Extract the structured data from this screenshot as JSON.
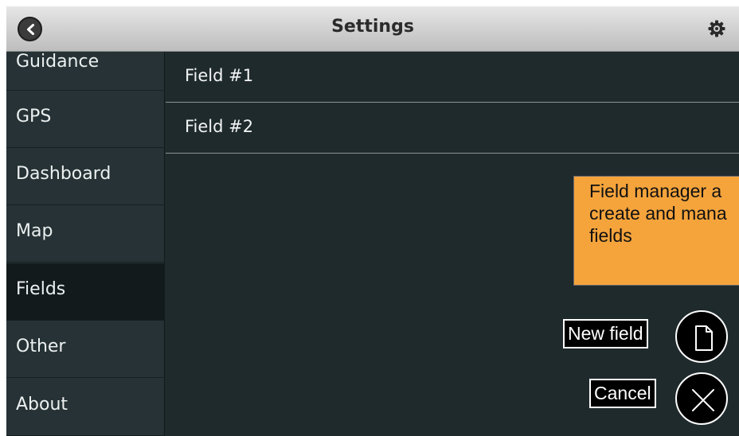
{
  "header": {
    "title": "Settings",
    "back_icon": "chevron-left-icon",
    "settings_icon": "gear-icon"
  },
  "sidebar": {
    "items": [
      {
        "label": "Guidance",
        "active": false
      },
      {
        "label": "GPS",
        "active": false
      },
      {
        "label": "Dashboard",
        "active": false
      },
      {
        "label": "Map",
        "active": false
      },
      {
        "label": "Fields",
        "active": true
      },
      {
        "label": "Other",
        "active": false
      },
      {
        "label": "About",
        "active": false
      }
    ]
  },
  "main": {
    "fields": [
      "Field #1",
      "Field #2"
    ]
  },
  "tooltip": {
    "text": "Field manager a\ncreate and mana\nfields"
  },
  "actions": {
    "new_field_label": "New field",
    "new_field_icon": "document-icon",
    "cancel_label": "Cancel",
    "cancel_icon": "close-icon"
  },
  "colors": {
    "background": "#1f2a2d",
    "sidebar": "#263235",
    "active_item": "#121a1c",
    "tooltip": "#f5a43c"
  }
}
